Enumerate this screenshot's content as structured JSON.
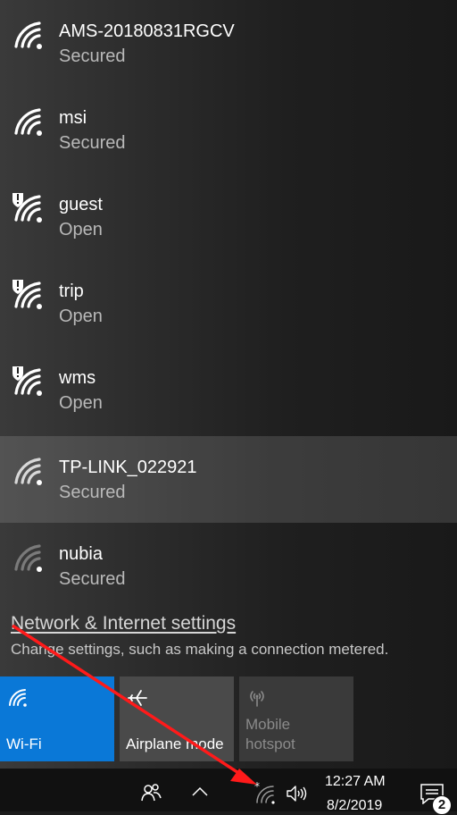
{
  "networks": [
    {
      "name": "AMS-20180831RGCV",
      "status": "Secured",
      "icon": "wifi-secured-icon"
    },
    {
      "name": "msi",
      "status": "Secured",
      "icon": "wifi-secured-icon"
    },
    {
      "name": "guest",
      "status": "Open",
      "icon": "wifi-open-warning-icon"
    },
    {
      "name": "trip",
      "status": "Open",
      "icon": "wifi-open-warning-icon"
    },
    {
      "name": "wms",
      "status": "Open",
      "icon": "wifi-open-warning-icon"
    },
    {
      "name": "TP-LINK_022921",
      "status": "Secured",
      "icon": "wifi-secured-icon",
      "selected": true
    },
    {
      "name": "nubia",
      "status": "Secured",
      "icon": "wifi-weak-icon"
    }
  ],
  "settings": {
    "link": "Network & Internet settings",
    "description": "Change settings, such as making a connection metered."
  },
  "quick_actions": {
    "wifi": "Wi-Fi",
    "airplane": "Airplane mode",
    "hotspot_line1": "Mobile",
    "hotspot_line2": "hotspot"
  },
  "taskbar": {
    "time": "12:27 AM",
    "date": "8/2/2019",
    "notification_count": "2"
  },
  "colors": {
    "accent": "#0a78d7",
    "annotation_arrow": "#ff1a1a"
  }
}
